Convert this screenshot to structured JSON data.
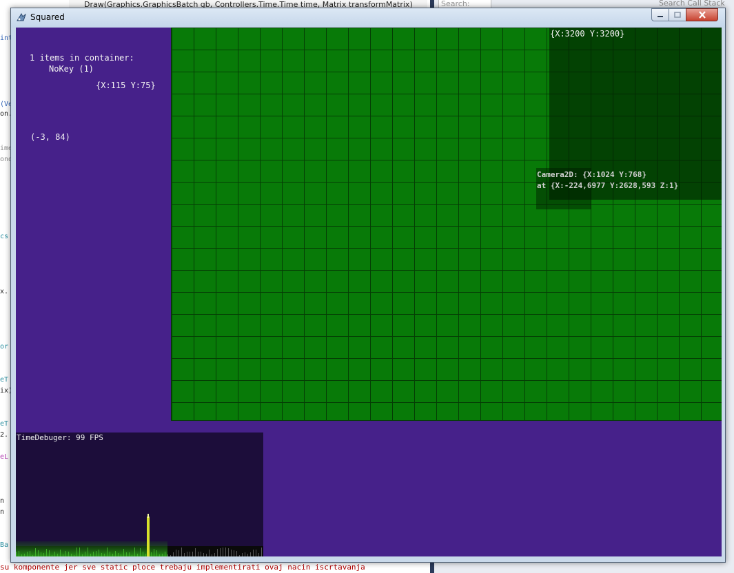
{
  "ide": {
    "tab_title": "Draw(Graphics.GraphicsBatch gb, Controllers.Time.Time time, Matrix transformMatrix)",
    "search_placeholder": "Search:",
    "search_call_stack": "Search Call Stack",
    "status_line": "su komponente jer sve static ploce trebaju implementirati ovaj nacin iscrtavanja"
  },
  "window": {
    "title": "Squared",
    "icon": "app-icon",
    "controls": {
      "minimize_icon": "minimize-icon",
      "maximize_icon": "maximize-icon",
      "close_icon": "close-icon"
    }
  },
  "game": {
    "container_info": {
      "line1": "1 items in container:",
      "line2": "NoKey (1)"
    },
    "mouse_position": "{X:115 Y:75}",
    "tile_coord": "(-3, 84)",
    "world_size": "{X:3200 Y:3200}",
    "camera": {
      "line1": "Camera2D: {X:1024 Y:768}",
      "line2": "at {X:-224,6977 Y:2628,593 Z:1}"
    },
    "time_debugger": {
      "label": "TimeDebuger: 99 FPS",
      "fps": 99
    }
  },
  "colors": {
    "background": "#46218a",
    "grid_fill": "#087a08",
    "grid_lines": "#053d05",
    "graph_panel": "#1c0d3a",
    "graph_base": "#1c6e14",
    "spike": "#d8e02a"
  }
}
